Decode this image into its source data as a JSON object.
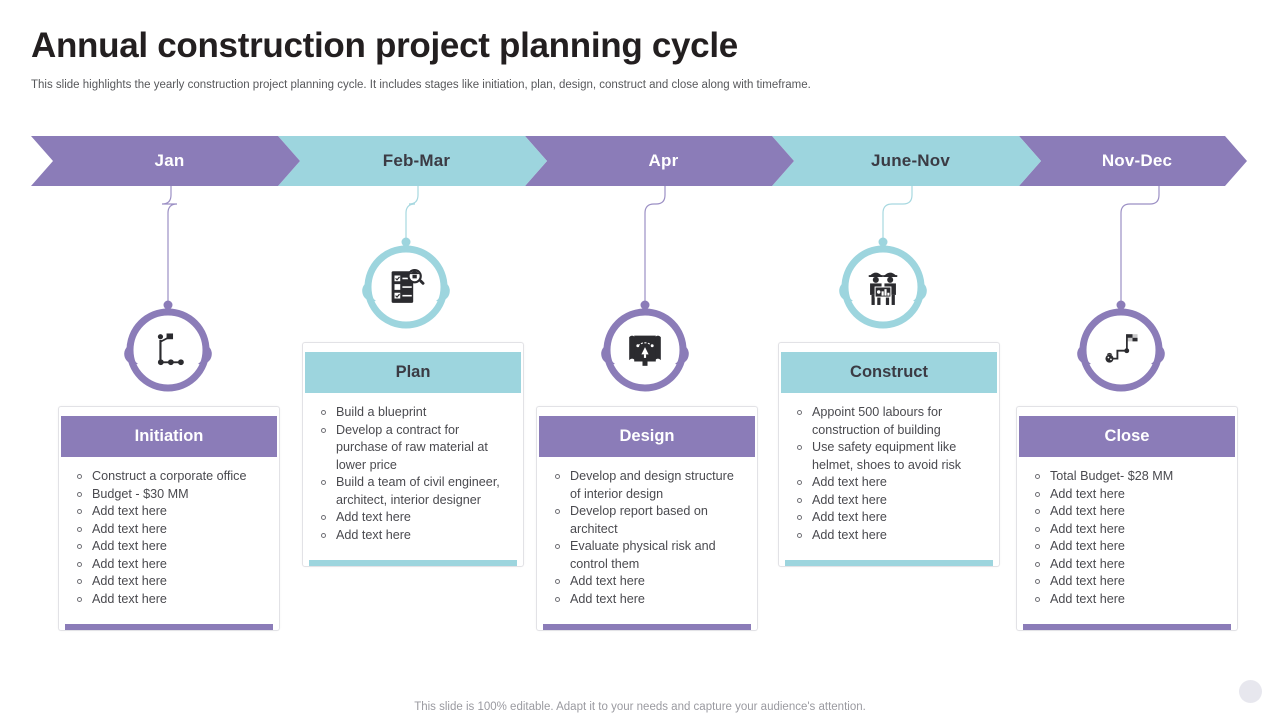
{
  "header": {
    "title": "Annual construction project planning cycle",
    "subtitle": "This slide highlights the yearly construction project planning cycle. It includes stages like initiation, plan, design, construct and close along with timeframe."
  },
  "colors": {
    "purple": "#8b7cb8",
    "teal": "#9dd5de",
    "title_text": "#231f20",
    "body_text": "#4a4a4f",
    "subtitle_text": "#57585b",
    "footer_text": "#9a9aa0"
  },
  "timeline": [
    {
      "label": "Jan",
      "theme": "purple"
    },
    {
      "label": "Feb-Mar",
      "theme": "teal"
    },
    {
      "label": "Apr",
      "theme": "purple"
    },
    {
      "label": "June-Nov",
      "theme": "teal"
    },
    {
      "label": "Nov-Dec",
      "theme": "purple"
    }
  ],
  "stages": [
    {
      "title": "Initiation",
      "theme": "purple",
      "icon": "person-with-flag-milestone-icon",
      "bullets": [
        "Construct a corporate office",
        "Budget - $30 MM",
        "Add text here",
        "Add text here",
        "Add text here",
        "Add text here",
        "Add text here",
        "Add text here"
      ]
    },
    {
      "title": "Plan",
      "theme": "teal",
      "icon": "checklist-magnifier-icon",
      "bullets": [
        "Build a blueprint",
        "Develop a contract for purchase of raw material at lower price",
        "Build a team of civil engineer, architect, interior designer",
        "Add text here",
        "Add text here"
      ]
    },
    {
      "title": "Design",
      "theme": "purple",
      "icon": "blueprint-pen-tool-icon",
      "bullets": [
        "Develop and design structure of interior design",
        "Develop report based on architect",
        "Evaluate physical risk and control them",
        "Add text here",
        "Add text here"
      ]
    },
    {
      "title": "Construct",
      "theme": "teal",
      "icon": "two-workers-hardhat-icon",
      "bullets": [
        "Appoint 500 labours for construction of building",
        "Use safety equipment like helmet, shoes to avoid risk",
        "Add text here",
        "Add text here",
        "Add text here",
        "Add text here"
      ]
    },
    {
      "title": "Close",
      "theme": "purple",
      "icon": "checkered-flag-goal-icon",
      "bullets": [
        "Total Budget- $28 MM",
        "Add text here",
        "Add text here",
        "Add text here",
        "Add text here",
        "Add text here",
        "Add text here",
        "Add text here"
      ]
    }
  ],
  "footer": {
    "note": "This slide is 100% editable. Adapt it to your needs and capture your audience's attention."
  }
}
